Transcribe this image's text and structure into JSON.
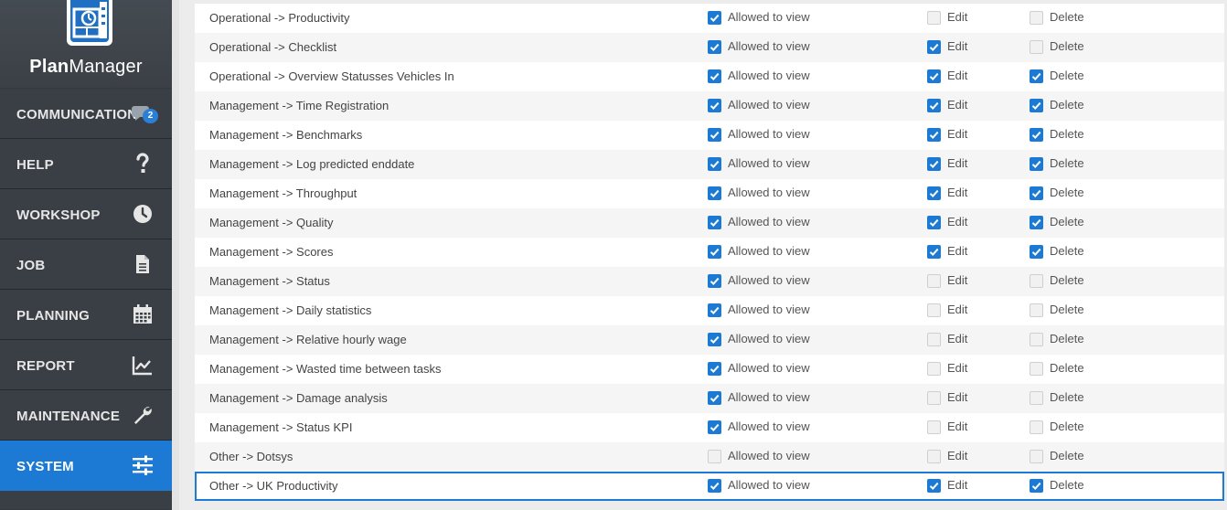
{
  "app": {
    "logo_bold": "Plan",
    "logo_rest": "Manager"
  },
  "nav": [
    {
      "label": "COMMUNICATION",
      "icon": "chat-icon",
      "badge": "2"
    },
    {
      "label": "HELP",
      "icon": "question-icon"
    },
    {
      "label": "WORKSHOP",
      "icon": "clock-icon"
    },
    {
      "label": "JOB",
      "icon": "document-icon"
    },
    {
      "label": "PLANNING",
      "icon": "calendar-icon"
    },
    {
      "label": "REPORT",
      "icon": "chart-icon"
    },
    {
      "label": "MAINTENANCE",
      "icon": "wrench-icon"
    },
    {
      "label": "SYSTEM",
      "icon": "sliders-icon",
      "active": true
    }
  ],
  "permission_labels": {
    "view": "Allowed to view",
    "edit": "Edit",
    "delete": "Delete"
  },
  "permissions": [
    {
      "name": "Operational -> Productivity",
      "view": true,
      "edit": false,
      "delete": false
    },
    {
      "name": "Operational -> Checklist",
      "view": true,
      "edit": true,
      "delete": false
    },
    {
      "name": "Operational -> Overview Statusses Vehicles In",
      "view": true,
      "edit": true,
      "delete": true
    },
    {
      "name": "Management -> Time Registration",
      "view": true,
      "edit": true,
      "delete": true
    },
    {
      "name": "Management -> Benchmarks",
      "view": true,
      "edit": true,
      "delete": true
    },
    {
      "name": "Management -> Log predicted enddate",
      "view": true,
      "edit": true,
      "delete": true
    },
    {
      "name": "Management -> Throughput",
      "view": true,
      "edit": true,
      "delete": true
    },
    {
      "name": "Management -> Quality",
      "view": true,
      "edit": true,
      "delete": true
    },
    {
      "name": "Management -> Scores",
      "view": true,
      "edit": true,
      "delete": true
    },
    {
      "name": "Management -> Status",
      "view": true,
      "edit": false,
      "delete": false
    },
    {
      "name": "Management -> Daily statistics",
      "view": true,
      "edit": false,
      "delete": false
    },
    {
      "name": "Management -> Relative hourly wage",
      "view": true,
      "edit": false,
      "delete": false
    },
    {
      "name": "Management -> Wasted time between tasks",
      "view": true,
      "edit": false,
      "delete": false
    },
    {
      "name": "Management -> Damage analysis",
      "view": true,
      "edit": false,
      "delete": false
    },
    {
      "name": "Management -> Status KPI",
      "view": true,
      "edit": false,
      "delete": false
    },
    {
      "name": "Other -> Dotsys",
      "view": false,
      "edit": false,
      "delete": false
    },
    {
      "name": "Other -> UK Productivity",
      "view": true,
      "edit": true,
      "delete": true,
      "selected": true
    }
  ],
  "colors": {
    "accent": "#1c7ad4",
    "sidebar": "#3a3f45"
  }
}
